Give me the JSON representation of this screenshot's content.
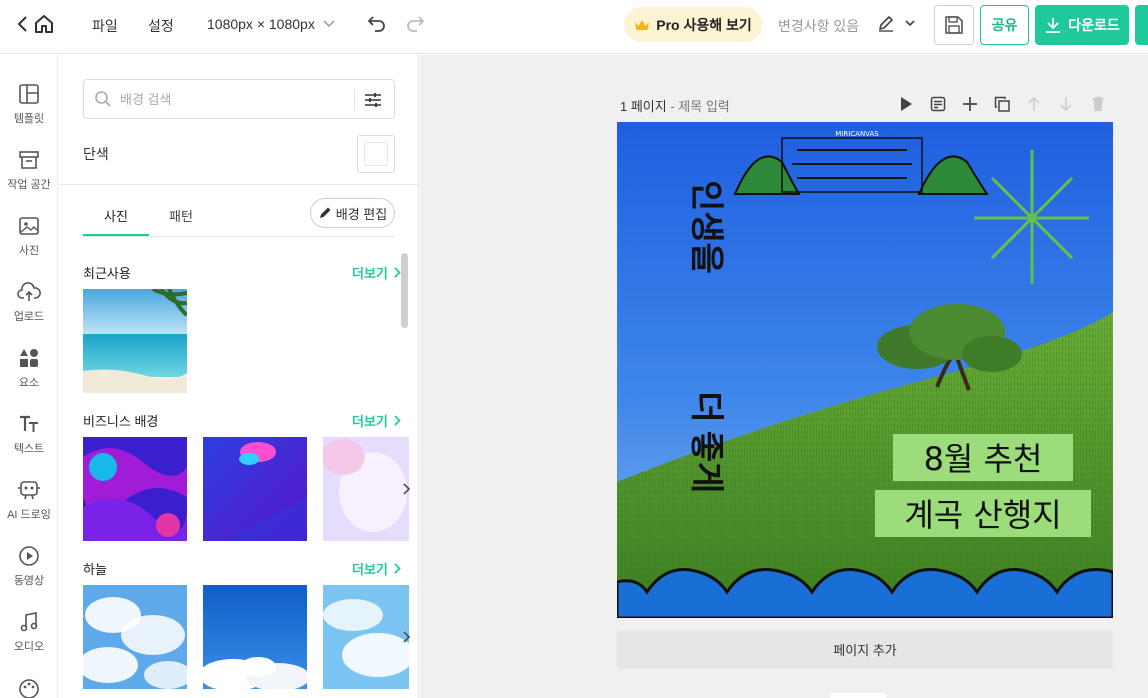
{
  "topbar": {
    "menu_file": "파일",
    "menu_settings": "설정",
    "canvas_size": "1080px × 1080px",
    "pro_label": "Pro 사용해 보기",
    "changes_status": "변경사항 있음",
    "share_label": "공유",
    "download_label": "다운로드"
  },
  "rail": {
    "items": [
      {
        "label": "템플릿",
        "icon": "template-icon"
      },
      {
        "label": "작업 공간",
        "icon": "workspace-box-icon"
      },
      {
        "label": "사진",
        "icon": "photo-icon"
      },
      {
        "label": "업로드",
        "icon": "upload-cloud-icon"
      },
      {
        "label": "요소",
        "icon": "elements-icon"
      },
      {
        "label": "텍스트",
        "icon": "text-icon"
      },
      {
        "label": "AI 드로잉",
        "icon": "ai-drawing-icon"
      },
      {
        "label": "동영상",
        "icon": "video-play-icon"
      },
      {
        "label": "오디오",
        "icon": "audio-note-icon"
      }
    ]
  },
  "panel": {
    "search_placeholder": "배경 검색",
    "solid_label": "단색",
    "tabs": [
      "사진",
      "패턴"
    ],
    "bg_edit_label": "배경 편집",
    "sections": [
      {
        "title": "최근사용",
        "more": "더보기"
      },
      {
        "title": "비즈니스 배경",
        "more": "더보기"
      },
      {
        "title": "하늘",
        "more": "더보기"
      }
    ]
  },
  "canvas": {
    "page_label": "1 페이지",
    "page_title_placeholder": "- 제목 입력",
    "add_page_label": "페이지 추가",
    "design": {
      "vertical_text_top": "인생을",
      "vertical_text_mid": "더",
      "vertical_text_bottom": "좋게",
      "headline_1": "8월 추천",
      "headline_2": "계곡 산행지",
      "stamp_text": "MIRICANVAS"
    }
  },
  "colors": {
    "accent": "#1fc99b",
    "sky": "#2f6fe8",
    "grass": "#4f9a2e",
    "highlight": "#9ddc7a"
  }
}
